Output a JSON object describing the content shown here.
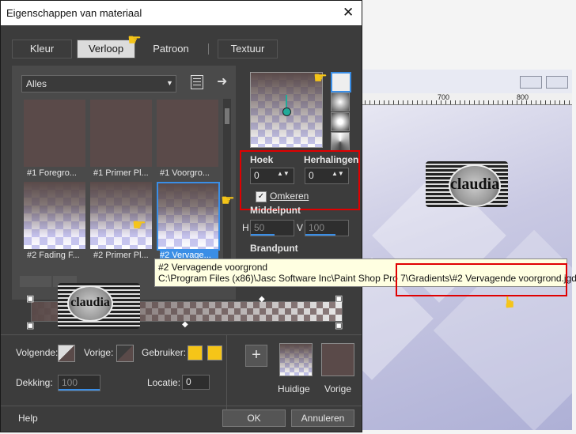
{
  "window": {
    "title": "Eigenschappen van materiaal",
    "close_icon": "close-icon"
  },
  "tabs": [
    {
      "label": "Kleur"
    },
    {
      "label": "Verloop",
      "active": true
    },
    {
      "label": "Patroon"
    },
    {
      "label": "Textuur"
    }
  ],
  "category": {
    "selected": "Alles"
  },
  "thumbnails": [
    {
      "label": "#1 Foregro..."
    },
    {
      "label": "#1 Primer Pl..."
    },
    {
      "label": "#1 Voorgro..."
    },
    {
      "label": "#2 Fading F..."
    },
    {
      "label": "#2 Primer Pl..."
    },
    {
      "label": "#2 Vervage..."
    }
  ],
  "style": {
    "hoek_label": "Hoek",
    "hoek_value": "0",
    "herhalingen_label": "Herhalingen",
    "herhalingen_value": "0",
    "omkeren_label": "Omkeren",
    "omkeren_checked": true,
    "middelpunt_label": "Middelpunt",
    "h_label": "H",
    "h_value": "50",
    "v_label": "V",
    "v_value": "100",
    "brandpunt_label": "Brandpunt"
  },
  "tooltip": {
    "line1": "#2 Vervagende voorgrond",
    "line2_path": "C:\\Program Files (x86)\\Jasc Software Inc\\Paint Shop Pro 7\\",
    "line2_file": "Gradients\\#2 Vervagende voorgrond.jgd"
  },
  "bottom": {
    "volgende_label": "Volgende:",
    "vorige_label": "Vorige:",
    "gebruiker_label": "Gebruiker:",
    "dekking_label": "Dekking:",
    "dekking_value": "100",
    "locatie_label": "Locatie:",
    "locatie_value": "0",
    "huidige_label": "Huidige",
    "vorige_swatch_label": "Vorige"
  },
  "footer": {
    "help": "Help",
    "ok": "OK",
    "annuleren": "Annuleren"
  },
  "logo_text": "claudia",
  "background": {
    "ruler_700": "700",
    "ruler_800": "800"
  },
  "colors": {
    "accent_blue": "#3a8ee6",
    "highlight_red": "#e00000",
    "user_yellow": "#f5c518",
    "brown": "#5a4a49",
    "lavender": "#c8c8f0"
  }
}
